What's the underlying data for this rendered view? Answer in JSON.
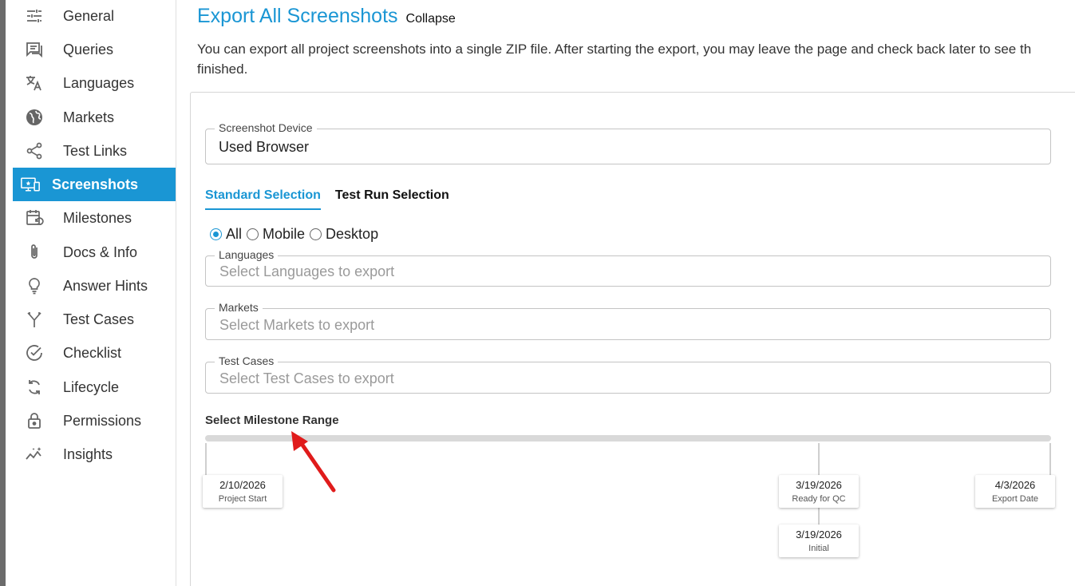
{
  "sidebar": {
    "items": [
      {
        "label": "General",
        "icon": "sliders-icon",
        "active": false
      },
      {
        "label": "Queries",
        "icon": "chat-icon",
        "active": false
      },
      {
        "label": "Languages",
        "icon": "translate-icon",
        "active": false
      },
      {
        "label": "Markets",
        "icon": "globe-icon",
        "active": false
      },
      {
        "label": "Test Links",
        "icon": "share-icon",
        "active": false
      },
      {
        "label": "Screenshots",
        "icon": "screenshot-icon",
        "active": true
      },
      {
        "label": "Milestones",
        "icon": "calendar-icon",
        "active": false
      },
      {
        "label": "Docs & Info",
        "icon": "paperclip-icon",
        "active": false
      },
      {
        "label": "Answer Hints",
        "icon": "lightbulb-icon",
        "active": false
      },
      {
        "label": "Test Cases",
        "icon": "fork-icon",
        "active": false
      },
      {
        "label": "Checklist",
        "icon": "check-circle-icon",
        "active": false
      },
      {
        "label": "Lifecycle",
        "icon": "refresh-icon",
        "active": false
      },
      {
        "label": "Permissions",
        "icon": "lock-icon",
        "active": false
      },
      {
        "label": "Insights",
        "icon": "insights-icon",
        "active": false
      }
    ]
  },
  "header": {
    "title": "Export All Screenshots",
    "collapse_label": "Collapse",
    "description_line1": "You can export all project screenshots into a single ZIP file. After starting the export, you may leave the page and check back later to see th",
    "description_line2": "finished."
  },
  "form": {
    "device": {
      "label": "Screenshot Device",
      "value": "Used Browser"
    },
    "tabs": [
      {
        "label": "Standard Selection",
        "active": true
      },
      {
        "label": "Test Run Selection",
        "active": false
      }
    ],
    "radios": [
      {
        "label": "All",
        "checked": true
      },
      {
        "label": "Mobile",
        "checked": false
      },
      {
        "label": "Desktop",
        "checked": false
      }
    ],
    "languages": {
      "label": "Languages",
      "placeholder": "Select Languages to export"
    },
    "markets": {
      "label": "Markets",
      "placeholder": "Select Markets to export"
    },
    "test_cases": {
      "label": "Test Cases",
      "placeholder": "Select Test Cases to export"
    }
  },
  "milestone_range": {
    "label": "Select Milestone Range",
    "milestones": [
      {
        "date": "2/10/2026",
        "name": "Project Start"
      },
      {
        "date": "3/19/2026",
        "name": "Ready for QC"
      },
      {
        "date": "3/19/2026",
        "name": "Initial"
      },
      {
        "date": "4/3/2026",
        "name": "Export Date"
      }
    ]
  },
  "colors": {
    "accent": "#1a96d4",
    "annotation_arrow": "#e01b1b"
  }
}
